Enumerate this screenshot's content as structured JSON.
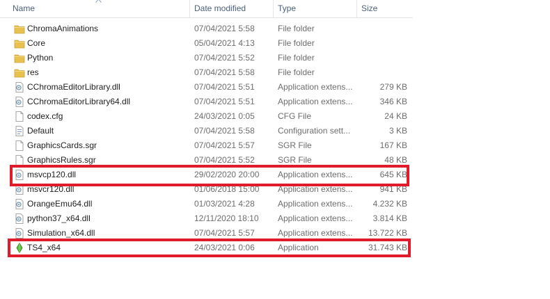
{
  "header": {
    "name": "Name",
    "date_modified": "Date modified",
    "type": "Type",
    "size": "Size"
  },
  "colors": {
    "highlight": "#e01c2a",
    "folder": "#e8c14e",
    "header_text": "#4c607a"
  },
  "files": [
    {
      "icon": "folder-icon",
      "name": "ChromaAnimations",
      "date": "07/04/2021 5:58",
      "type": "File folder",
      "size": ""
    },
    {
      "icon": "folder-icon",
      "name": "Core",
      "date": "05/04/2021 4:13",
      "type": "File folder",
      "size": ""
    },
    {
      "icon": "folder-icon",
      "name": "Python",
      "date": "07/04/2021 5:52",
      "type": "File folder",
      "size": ""
    },
    {
      "icon": "folder-icon",
      "name": "res",
      "date": "07/04/2021 5:58",
      "type": "File folder",
      "size": ""
    },
    {
      "icon": "dll-icon",
      "name": "CChromaEditorLibrary.dll",
      "date": "07/04/2021 5:51",
      "type": "Application extens...",
      "size": "279 KB"
    },
    {
      "icon": "dll-icon",
      "name": "CChromaEditorLibrary64.dll",
      "date": "07/04/2021 5:51",
      "type": "Application extens...",
      "size": "346 KB"
    },
    {
      "icon": "file-icon",
      "name": "codex.cfg",
      "date": "24/03/2021 0:05",
      "type": "CFG File",
      "size": "24 KB"
    },
    {
      "icon": "settings-file-icon",
      "name": "Default",
      "date": "07/04/2021 5:58",
      "type": "Configuration sett...",
      "size": "3 KB"
    },
    {
      "icon": "file-icon",
      "name": "GraphicsCards.sgr",
      "date": "07/04/2021 5:57",
      "type": "SGR File",
      "size": "167 KB"
    },
    {
      "icon": "file-icon",
      "name": "GraphicsRules.sgr",
      "date": "07/04/2021 5:52",
      "type": "SGR File",
      "size": "48 KB"
    },
    {
      "icon": "dll-icon",
      "name": "msvcp120.dll",
      "date": "29/02/2020 20:00",
      "type": "Application extens...",
      "size": "645 KB"
    },
    {
      "icon": "dll-icon",
      "name": "msvcr120.dll",
      "date": "01/06/2018 15:00",
      "type": "Application extens...",
      "size": "941 KB"
    },
    {
      "icon": "dll-icon",
      "name": "OrangeEmu64.dll",
      "date": "01/03/2021 4:28",
      "type": "Application extens...",
      "size": "4.232 KB"
    },
    {
      "icon": "dll-icon",
      "name": "python37_x64.dll",
      "date": "12/11/2020 18:10",
      "type": "Application extens...",
      "size": "3.814 KB"
    },
    {
      "icon": "dll-icon",
      "name": "Simulation_x64.dll",
      "date": "07/04/2021 5:57",
      "type": "Application extens...",
      "size": "13.722 KB"
    },
    {
      "icon": "sims-app-icon",
      "name": "TS4_x64",
      "date": "24/03/2021 0:06",
      "type": "Application",
      "size": "31.743 KB"
    }
  ]
}
